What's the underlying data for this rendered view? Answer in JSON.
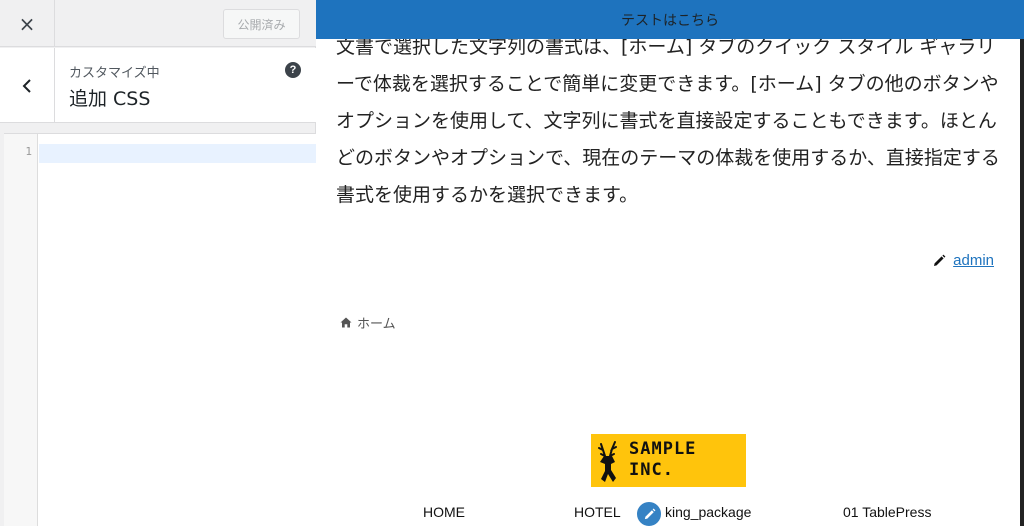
{
  "header": {
    "close_icon": "×",
    "publish_label": "公開済み"
  },
  "section": {
    "subtitle": "カスタマイズ中",
    "title": "追加 CSS",
    "help_icon": "?"
  },
  "editor": {
    "line_number": "1",
    "content": ""
  },
  "preview": {
    "topbar_text": "テストはこちら",
    "topbar_color": "#1e73be",
    "body_text": "文書で選択した文字列の書式は、[ホーム] タブのクイック スタイル ギャラリーで体裁を選択することで簡単に変更できます。[ホーム] タブの他のボタンやオプションを使用して、文字列に書式を直接設定することもできます。ほとんどのボタンやオプションで、現在のテーマの体裁を使用するか、直接指定する書式を使用するかを選択できます。",
    "author": "admin",
    "breadcrumb": "ホーム",
    "logo_line1": "SAMPLE",
    "logo_line2": "INC.",
    "logo_color": "#ffc40c",
    "nav": [
      "HOME",
      "HOTEL",
      "king_package",
      "01 TablePress"
    ]
  }
}
